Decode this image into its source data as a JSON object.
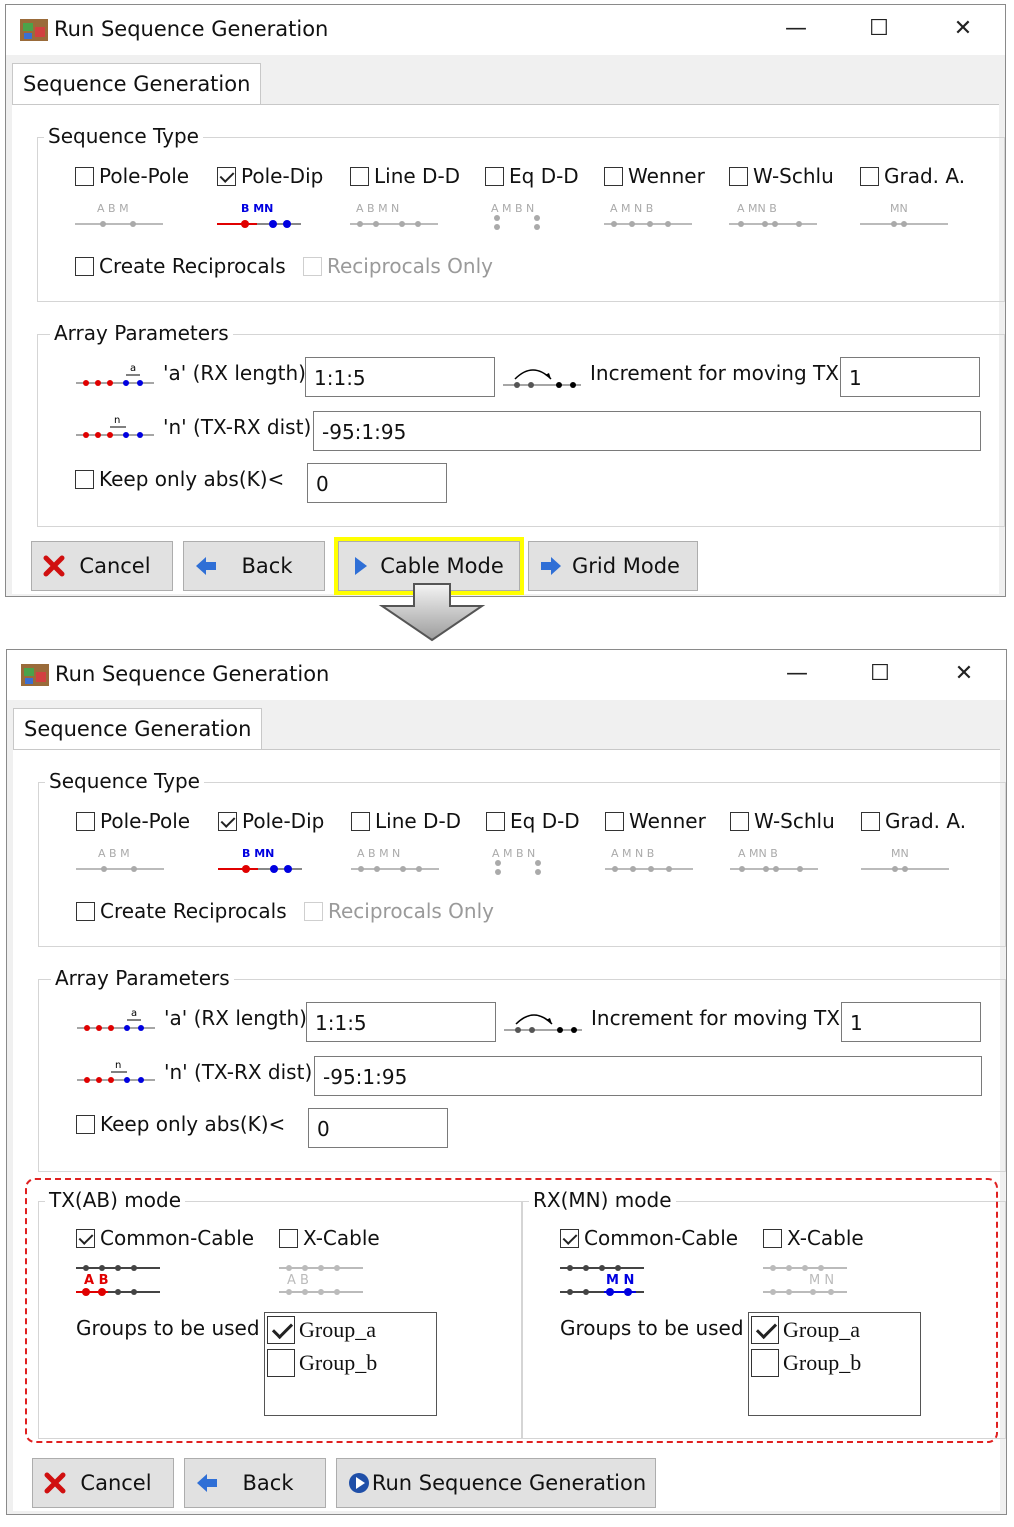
{
  "window_title": "Run Sequence Generation",
  "window_controls": {
    "minimize": "—",
    "maximize": "☐",
    "close": "✕"
  },
  "tab_label": "Sequence Generation",
  "sequence_type": {
    "legend": "Sequence Type",
    "options": [
      {
        "label": "Pole-Pole",
        "checked": false,
        "diagram_labels": "A B M"
      },
      {
        "label": "Pole-Dip",
        "checked": true,
        "diagram_labels": "B MN"
      },
      {
        "label": "Line D-D",
        "checked": false,
        "diagram_labels": "A B M N"
      },
      {
        "label": "Eq D-D",
        "checked": false,
        "diagram_labels": "A M B N"
      },
      {
        "label": "Wenner",
        "checked": false,
        "diagram_labels": "A M N B"
      },
      {
        "label": "W-Schlu",
        "checked": false,
        "diagram_labels": "A MN B"
      },
      {
        "label": "Grad. A.",
        "checked": false,
        "diagram_labels": "MN"
      }
    ],
    "create_reciprocals": "Create Reciprocals",
    "reciprocals_only": "Reciprocals Only"
  },
  "array_parameters": {
    "legend": "Array Parameters",
    "a_label": "'a' (RX length)",
    "a_value": "1:1:5",
    "increment_label": "Increment for moving TX",
    "increment_value": "1",
    "n_label": "'n' (TX-RX dist)",
    "n_value": "-95:1:95",
    "keep_label": "Keep only abs(K)<",
    "keep_value": "0"
  },
  "top_buttons": {
    "cancel": "Cancel",
    "back": "Back",
    "cable_mode": "Cable Mode",
    "grid_mode": "Grid Mode"
  },
  "tx_mode": {
    "legend": "TX(AB) mode",
    "common_cable": "Common-Cable",
    "x_cable": "X-Cable",
    "groups_label": "Groups to be used",
    "groups": [
      {
        "name": "Group_a",
        "checked": true
      },
      {
        "name": "Group_b",
        "checked": false
      }
    ]
  },
  "rx_mode": {
    "legend": "RX(MN) mode",
    "common_cable": "Common-Cable",
    "x_cable": "X-Cable",
    "groups_label": "Groups to be used",
    "groups": [
      {
        "name": "Group_a",
        "checked": true
      },
      {
        "name": "Group_b",
        "checked": false
      }
    ]
  },
  "bottom_buttons": {
    "cancel": "Cancel",
    "back": "Back",
    "run": "Run Sequence Generation"
  },
  "colors": {
    "highlight": "#ffff00",
    "callout": "#e02020",
    "tx_red": "#e00000",
    "rx_blue": "#0000e0"
  }
}
